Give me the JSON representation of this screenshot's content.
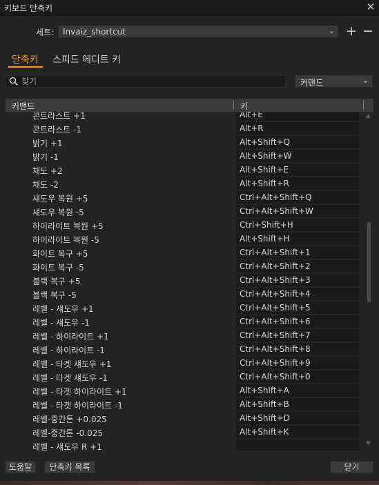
{
  "window": {
    "title": "키보드 단축키",
    "close_glyph": "✕"
  },
  "preset": {
    "label": "세트:",
    "value": "Invaiz_shortcut",
    "add_glyph": "+",
    "remove_glyph": "−"
  },
  "tabs": [
    {
      "label": "단축키",
      "active": true
    },
    {
      "label": "스피드 에디트 키",
      "active": false
    }
  ],
  "search": {
    "placeholder": "찾기",
    "value": ""
  },
  "filter": {
    "value": "커맨드"
  },
  "table": {
    "headers": {
      "command": "커맨드",
      "key": "키"
    },
    "rows": [
      {
        "command": "콘트라스트 +1",
        "key": "Alt+E"
      },
      {
        "command": "콘트라스트 -1",
        "key": "Alt+R"
      },
      {
        "command": "밝기 +1",
        "key": "Alt+Shift+Q"
      },
      {
        "command": "밝기 -1",
        "key": "Alt+Shift+W"
      },
      {
        "command": "채도 +2",
        "key": "Alt+Shift+E"
      },
      {
        "command": "채도 -2",
        "key": "Alt+Shift+R"
      },
      {
        "command": "섀도우 복원 +5",
        "key": "Ctrl+Alt+Shift+Q"
      },
      {
        "command": "섀도우 복원 -5",
        "key": "Ctrl+Alt+Shift+W"
      },
      {
        "command": "하이라이트 복원 +5",
        "key": "Ctrl+Shift+H"
      },
      {
        "command": "하이라이트 복원 -5",
        "key": "Alt+Shift+H"
      },
      {
        "command": "화이트 복구 +5",
        "key": "Ctrl+Alt+Shift+1"
      },
      {
        "command": "화이트 복구 -5",
        "key": "Ctrl+Alt+Shift+2"
      },
      {
        "command": "블랙 복구 +5",
        "key": "Ctrl+Alt+Shift+3"
      },
      {
        "command": "블랙 복구 -5",
        "key": "Ctrl+Alt+Shift+4"
      },
      {
        "command": "레벨 - 섀도우 +1",
        "key": "Ctrl+Alt+Shift+5"
      },
      {
        "command": "레벨 - 섀도우 -1",
        "key": "Ctrl+Alt+Shift+6"
      },
      {
        "command": "레벨 - 하이라이트 +1",
        "key": "Ctrl+Alt+Shift+7"
      },
      {
        "command": "레벨 - 하이라이트 -1",
        "key": "Ctrl+Alt+Shift+8"
      },
      {
        "command": "레벨 - 타겟 섀도우 +1",
        "key": "Ctrl+Alt+Shift+9"
      },
      {
        "command": "레벨 - 타겟 섀도우 -1",
        "key": "Ctrl+Alt+Shift+0"
      },
      {
        "command": "레벨 - 타겟 하이라이트 +1",
        "key": "Alt+Shift+A"
      },
      {
        "command": "레벨 - 타겟 하이라이트 -1",
        "key": "Alt+Shift+B"
      },
      {
        "command": "레벨-중간톤 +0.025",
        "key": "Alt+Shift+D"
      },
      {
        "command": "레벨-중간톤 -0.025",
        "key": "Alt+Shift+K"
      },
      {
        "command": "레벨 - 섀도우 R +1",
        "key": ""
      }
    ]
  },
  "footer": {
    "help_label": "도움말",
    "list_label": "단축키 목록",
    "close_label": "닫기"
  },
  "colors": {
    "accent": "#f29b2e",
    "background": "#232323"
  }
}
